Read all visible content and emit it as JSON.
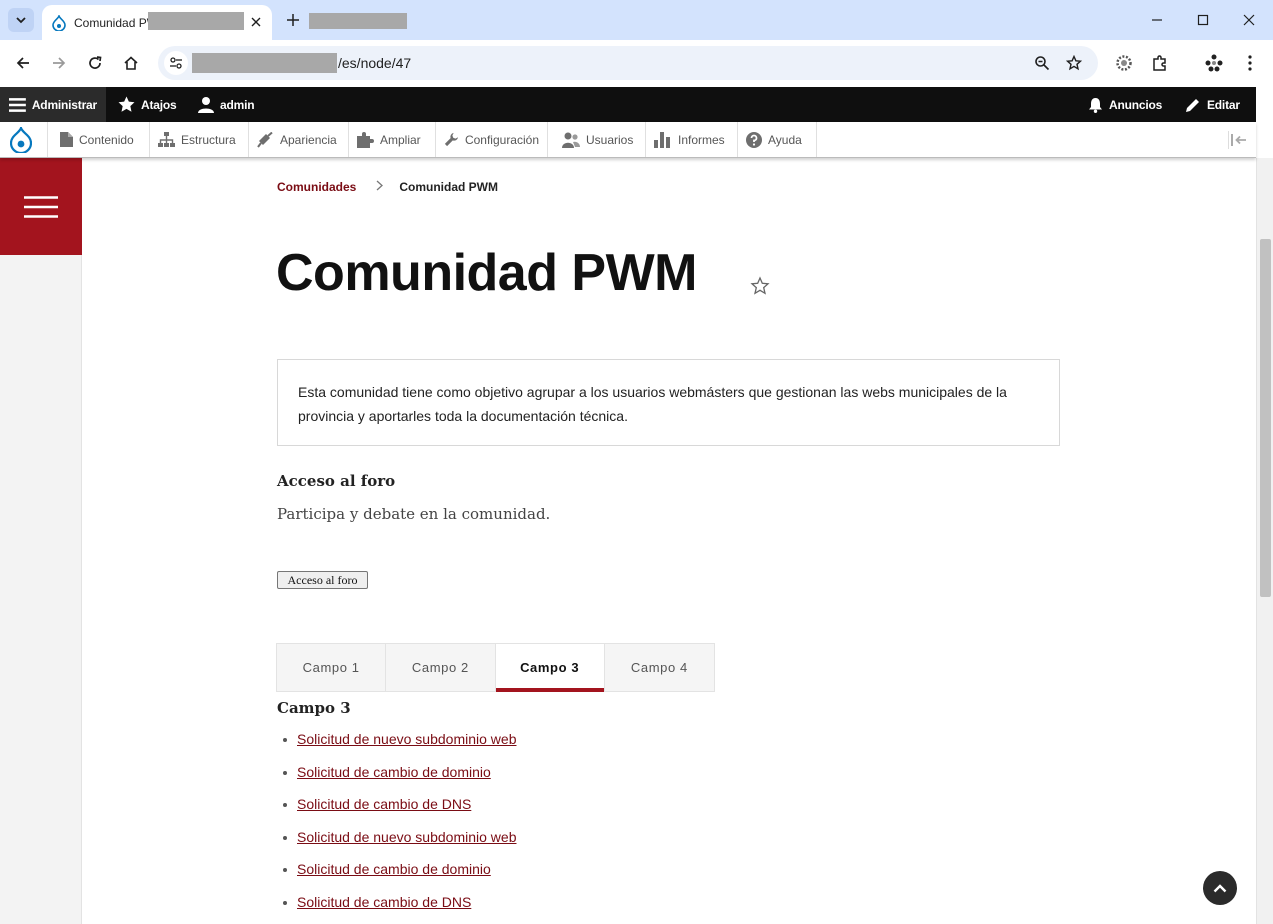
{
  "browser": {
    "tab_title": "Comunidad PW",
    "url_suffix": "/es/node/47"
  },
  "admin_bar": {
    "manage": "Administrar",
    "shortcuts": "Atajos",
    "user": "admin",
    "announcements": "Anuncios",
    "edit": "Editar"
  },
  "admin_tray": {
    "items": [
      "Contenido",
      "Estructura",
      "Apariencia",
      "Ampliar",
      "Configuración",
      "Usuarios",
      "Informes",
      "Ayuda"
    ]
  },
  "breadcrumb": {
    "parent": "Comunidades",
    "current": "Comunidad PWM"
  },
  "page": {
    "title": "Comunidad PWM",
    "summary": "Esta comunidad tiene como objetivo agrupar a los usuarios webmásters que gestionan las webs municipales de la provincia y aportarles toda la documentación técnica.",
    "forum_heading": "Acceso al foro",
    "forum_text": "Participa y debate en la comunidad.",
    "forum_button": "Acceso al foro"
  },
  "tabs": {
    "items": [
      "Campo 1",
      "Campo 2",
      "Campo 3",
      "Campo 4"
    ],
    "active_index": 2
  },
  "active_panel": {
    "heading": "Campo 3",
    "links": [
      "Solicitud de nuevo subdominio web",
      "Solicitud de cambio de dominio",
      "Solicitud de cambio de DNS",
      "Solicitud de nuevo subdominio web",
      "Solicitud de cambio de dominio",
      "Solicitud de cambio de DNS"
    ]
  },
  "colors": {
    "brand_red": "#a3141e",
    "link_red": "#7a0c14",
    "admin_bar_bg": "#0f0f0f",
    "chrome_tabbar": "#d3e3fd"
  }
}
